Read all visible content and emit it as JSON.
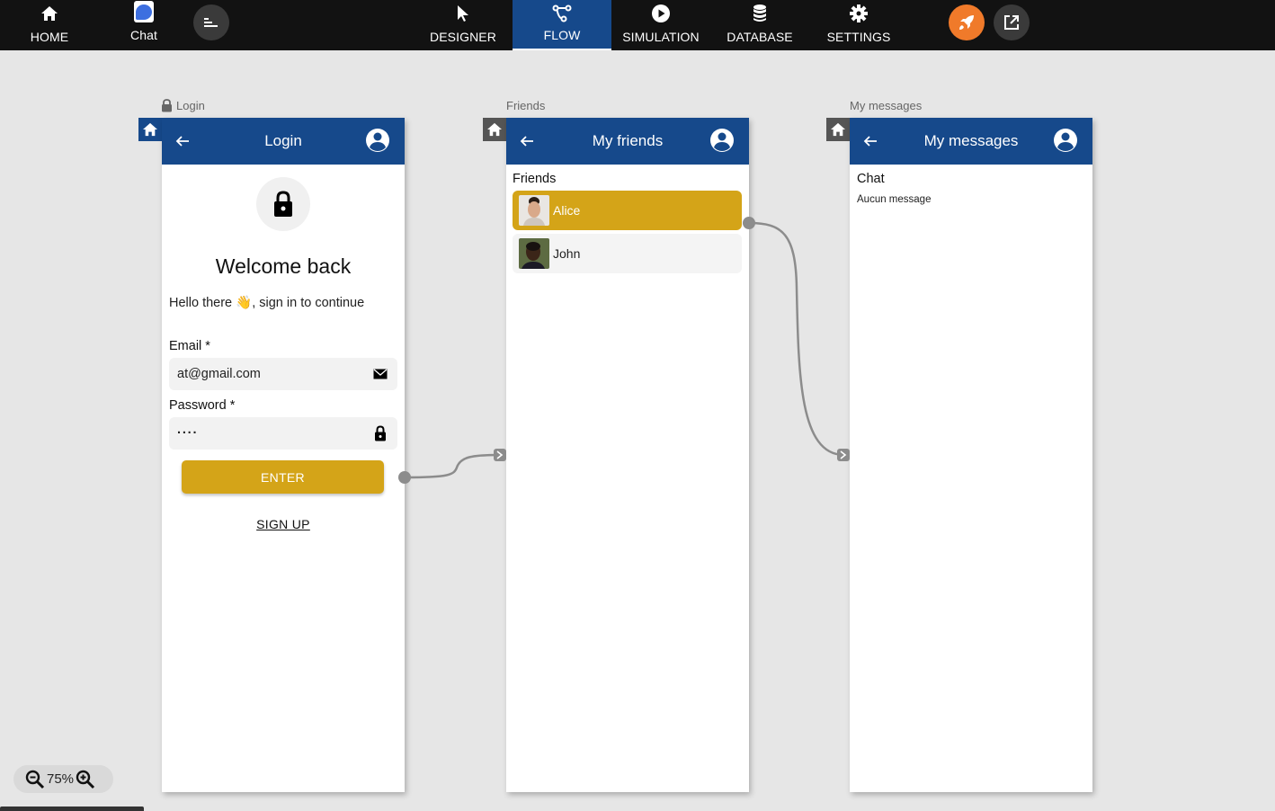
{
  "topbar": {
    "nav": [
      {
        "label": "HOME",
        "icon": "home-icon"
      },
      {
        "label": "Chat",
        "icon": "chat-app-icon"
      },
      {
        "label": "DESIGNER",
        "icon": "cursor-icon"
      },
      {
        "label": "FLOW",
        "icon": "flow-icon",
        "active": true
      },
      {
        "label": "SIMULATION",
        "icon": "play-icon"
      },
      {
        "label": "DATABASE",
        "icon": "database-icon"
      },
      {
        "label": "SETTINGS",
        "icon": "gear-icon"
      }
    ],
    "accent_color": "#16498b",
    "publish_color": "#f07a2a"
  },
  "screens": {
    "login": {
      "label": "Login",
      "appbar_title": "Login",
      "welcome": "Welcome back",
      "hello": "Hello there 👋, sign in to continue",
      "email_label": "Email *",
      "email_value": "at@gmail.com",
      "password_label": "Password *",
      "password_value": "····",
      "enter_label": "ENTER",
      "signup_label": "SIGN UP"
    },
    "friends": {
      "label": "Friends",
      "appbar_title": "My friends",
      "section_title": "Friends",
      "items": [
        {
          "name": "Alice",
          "selected": true
        },
        {
          "name": "John",
          "selected": false
        }
      ]
    },
    "messages": {
      "label": "My messages",
      "appbar_title": "My messages",
      "section_title": "Chat",
      "empty_text": "Aucun message"
    }
  },
  "zoom": {
    "level": "75%"
  },
  "colors": {
    "button_gold": "#d4a418",
    "canvas_bg": "#e6e6e6"
  }
}
